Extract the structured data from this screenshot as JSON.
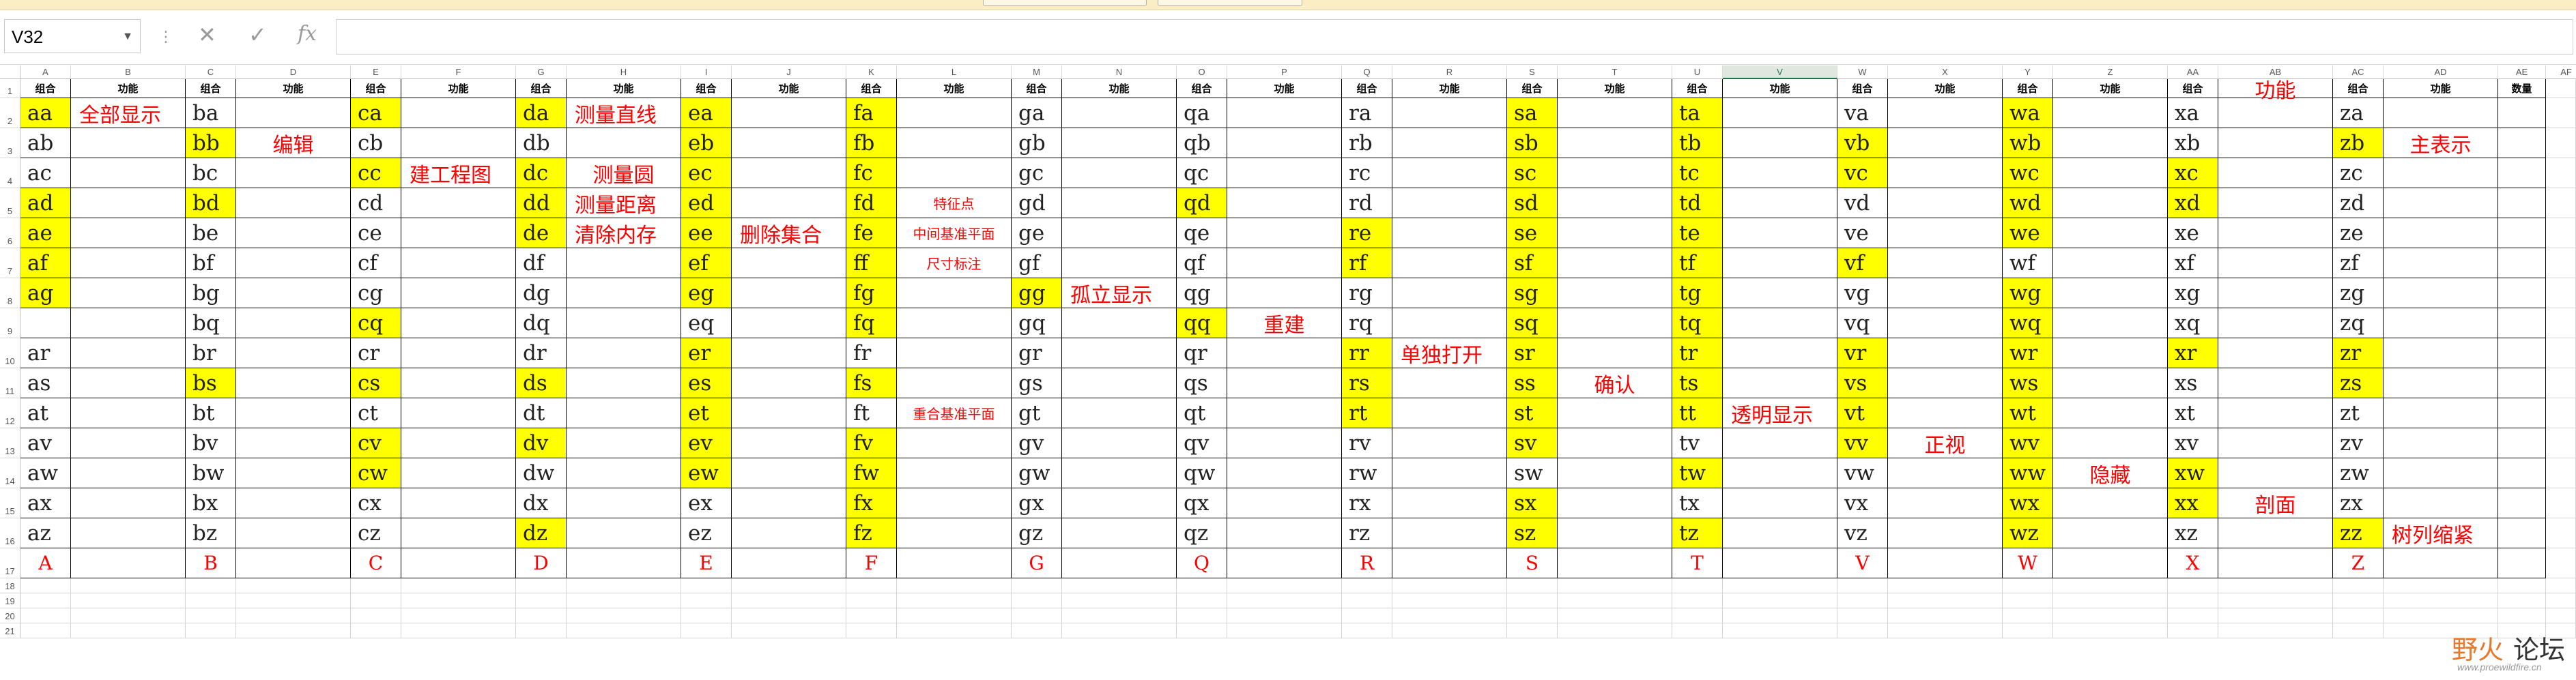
{
  "name_box": "V32",
  "formula_icons": {
    "cancel": "✕",
    "enter": "✓",
    "fx": "fx"
  },
  "columns": [
    "A",
    "B",
    "C",
    "D",
    "E",
    "F",
    "G",
    "H",
    "I",
    "J",
    "K",
    "L",
    "M",
    "N",
    "O",
    "P",
    "Q",
    "R",
    "S",
    "T",
    "U",
    "V",
    "W",
    "X",
    "Y",
    "Z",
    "AA",
    "AB",
    "AC",
    "AD",
    "AE",
    "AF"
  ],
  "rows": [
    "1",
    "2",
    "3",
    "4",
    "5",
    "6",
    "7",
    "8",
    "9",
    "10",
    "11",
    "12",
    "13",
    "14",
    "15",
    "16",
    "17",
    "18",
    "19",
    "20",
    "21"
  ],
  "selected_column": "V",
  "header_row": {
    "combo": "组合",
    "func": "功能",
    "big_func": "功能",
    "count": "数量"
  },
  "groups": [
    {
      "combos": [
        "aa",
        "ab",
        "ac",
        "ad",
        "ae",
        "af",
        "ag",
        "",
        "ar",
        "as",
        "at",
        "av",
        "aw",
        "ax",
        "az"
      ],
      "yellow": [
        0,
        3,
        4,
        5,
        6
      ],
      "key": "A",
      "funcs": [
        {
          "row": 0,
          "text": "全部显示"
        }
      ]
    },
    {
      "combos": [
        "ba",
        "bb",
        "bc",
        "bd",
        "be",
        "bf",
        "bg",
        "bq",
        "br",
        "bs",
        "bt",
        "bv",
        "bw",
        "bx",
        "bz"
      ],
      "yellow": [
        1,
        3,
        9
      ],
      "key": "B",
      "funcs": [
        {
          "row": 1,
          "text": "编辑",
          "center": true
        }
      ]
    },
    {
      "combos": [
        "ca",
        "cb",
        "cc",
        "cd",
        "ce",
        "cf",
        "cg",
        "cq",
        "cr",
        "cs",
        "ct",
        "cv",
        "cw",
        "cx",
        "cz"
      ],
      "yellow": [
        0,
        2,
        7,
        9,
        11,
        12
      ],
      "key": "C",
      "funcs": [
        {
          "row": 2,
          "text": "建工程图"
        }
      ]
    },
    {
      "combos": [
        "da",
        "db",
        "dc",
        "dd",
        "de",
        "df",
        "dg",
        "dq",
        "dr",
        "ds",
        "dt",
        "dv",
        "dw",
        "dx",
        "dz"
      ],
      "yellow": [
        0,
        2,
        3,
        4,
        9,
        11,
        14
      ],
      "key": "D",
      "funcs": [
        {
          "row": 0,
          "text": "测量直线"
        },
        {
          "row": 2,
          "text": "测量圆",
          "center": true
        },
        {
          "row": 3,
          "text": "测量距离"
        },
        {
          "row": 4,
          "text": "清除内存"
        }
      ]
    },
    {
      "combos": [
        "ea",
        "eb",
        "ec",
        "ed",
        "ee",
        "ef",
        "eg",
        "eq",
        "er",
        "es",
        "et",
        "ev",
        "ew",
        "ex",
        "ez"
      ],
      "yellow": [
        0,
        1,
        2,
        3,
        4,
        5,
        6,
        8,
        9,
        10,
        11,
        12
      ],
      "key": "E",
      "funcs": [
        {
          "row": 4,
          "text": "删除集合"
        }
      ]
    },
    {
      "combos": [
        "fa",
        "fb",
        "fc",
        "fd",
        "fe",
        "ff",
        "fg",
        "fq",
        "fr",
        "fs",
        "ft",
        "fv",
        "fw",
        "fx",
        "fz"
      ],
      "yellow": [
        0,
        1,
        2,
        3,
        4,
        5,
        6,
        7,
        9,
        11,
        12,
        13,
        14
      ],
      "key": "F",
      "funcs": [
        {
          "row": 3,
          "text": "特征点",
          "small": true,
          "center": true
        },
        {
          "row": 4,
          "text": "中间基准平面",
          "small": true,
          "center": true
        },
        {
          "row": 5,
          "text": "尺寸标注",
          "small": true,
          "center": true
        },
        {
          "row": 10,
          "text": "重合基准平面",
          "small": true,
          "center": true
        }
      ]
    },
    {
      "combos": [
        "ga",
        "gb",
        "gc",
        "gd",
        "ge",
        "gf",
        "gg",
        "gq",
        "gr",
        "gs",
        "gt",
        "gv",
        "gw",
        "gx",
        "gz"
      ],
      "yellow": [
        6
      ],
      "key": "G",
      "funcs": [
        {
          "row": 6,
          "text": "孤立显示"
        }
      ]
    },
    {
      "combos": [
        "qa",
        "qb",
        "qc",
        "qd",
        "qe",
        "qf",
        "qg",
        "qq",
        "qr",
        "qs",
        "qt",
        "qv",
        "qw",
        "qx",
        "qz"
      ],
      "yellow": [
        3,
        7
      ],
      "key": "Q",
      "funcs": [
        {
          "row": 7,
          "text": "重建",
          "center": true
        }
      ]
    },
    {
      "combos": [
        "ra",
        "rb",
        "rc",
        "rd",
        "re",
        "rf",
        "rg",
        "rq",
        "rr",
        "rs",
        "rt",
        "rv",
        "rw",
        "rx",
        "rz"
      ],
      "yellow": [
        4,
        5,
        8,
        9,
        10
      ],
      "key": "R",
      "funcs": [
        {
          "row": 8,
          "text": "单独打开"
        }
      ]
    },
    {
      "combos": [
        "sa",
        "sb",
        "sc",
        "sd",
        "se",
        "sf",
        "sg",
        "sq",
        "sr",
        "ss",
        "st",
        "sv",
        "sw",
        "sx",
        "sz"
      ],
      "yellow": [
        0,
        1,
        2,
        3,
        4,
        5,
        6,
        7,
        8,
        9,
        10,
        11,
        13,
        14
      ],
      "key": "S",
      "funcs": [
        {
          "row": 9,
          "text": "确认",
          "center": true
        }
      ]
    },
    {
      "combos": [
        "ta",
        "tb",
        "tc",
        "td",
        "te",
        "tf",
        "tg",
        "tq",
        "tr",
        "ts",
        "tt",
        "tv",
        "tw",
        "tx",
        "tz"
      ],
      "yellow": [
        0,
        1,
        2,
        3,
        4,
        5,
        6,
        7,
        8,
        9,
        10,
        12,
        14
      ],
      "key": "T",
      "funcs": [
        {
          "row": 10,
          "text": "透明显示"
        }
      ]
    },
    {
      "combos": [
        "va",
        "vb",
        "vc",
        "vd",
        "ve",
        "vf",
        "vg",
        "vq",
        "vr",
        "vs",
        "vt",
        "vv",
        "vw",
        "vx",
        "vz"
      ],
      "yellow": [
        1,
        2,
        5,
        8,
        9,
        10,
        11
      ],
      "key": "V",
      "funcs": [
        {
          "row": 11,
          "text": "正视",
          "center": true
        }
      ]
    },
    {
      "combos": [
        "wa",
        "wb",
        "wc",
        "wd",
        "we",
        "wf",
        "wg",
        "wq",
        "wr",
        "ws",
        "wt",
        "wv",
        "ww",
        "wx",
        "wz"
      ],
      "yellow": [
        0,
        1,
        2,
        3,
        4,
        6,
        7,
        8,
        9,
        10,
        11,
        12,
        13,
        14
      ],
      "key": "W",
      "funcs": [
        {
          "row": 12,
          "text": "隐藏",
          "center": true
        }
      ]
    },
    {
      "combos": [
        "xa",
        "xb",
        "xc",
        "xd",
        "xe",
        "xf",
        "xg",
        "xq",
        "xr",
        "xs",
        "xt",
        "xv",
        "xw",
        "xx",
        "xz"
      ],
      "yellow": [
        2,
        3,
        8,
        12,
        13
      ],
      "key": "X",
      "funcs": [
        {
          "row": 13,
          "text": "剖面",
          "center": true
        }
      ]
    },
    {
      "combos": [
        "za",
        "zb",
        "zc",
        "zd",
        "ze",
        "zf",
        "zg",
        "zq",
        "zr",
        "zs",
        "zt",
        "zv",
        "zw",
        "zx",
        "zz"
      ],
      "yellow": [
        1,
        8,
        9,
        14
      ],
      "key": "Z",
      "funcs": [
        {
          "row": 1,
          "text": "主表示",
          "center": true
        },
        {
          "row": 14,
          "text": "树列缩紧"
        }
      ]
    }
  ],
  "x_header_func": "功能",
  "watermark": {
    "brand_a": "野火",
    "brand_b": "论坛",
    "url": "www.proewildfire.cn"
  }
}
